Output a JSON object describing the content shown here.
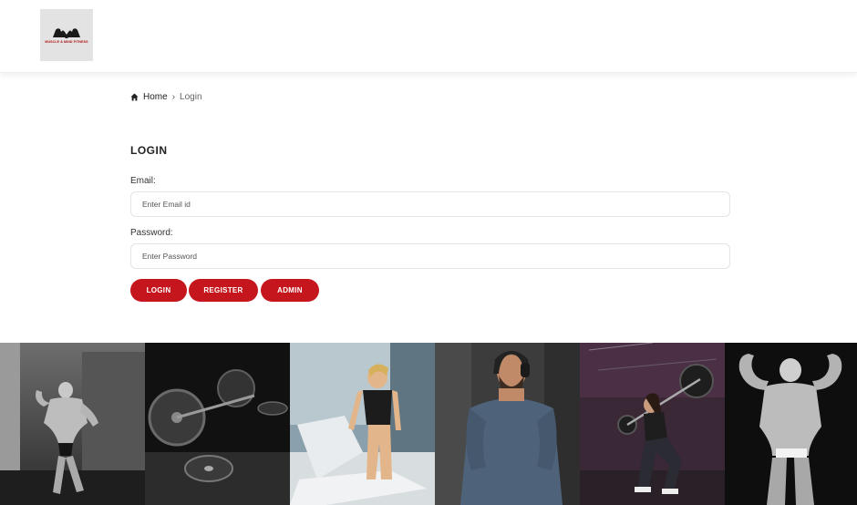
{
  "header": {
    "logo": {
      "brand_text": "MUSCLE & MIND FITNESS",
      "icon": "flexing-arms-logo"
    }
  },
  "breadcrumb": {
    "home_icon": "home-icon",
    "home_label": "Home",
    "separator": "›",
    "current_label": "Login"
  },
  "login_form": {
    "title": "LOGIN",
    "email_label": "Email:",
    "email_placeholder": "Enter Email id",
    "email_value": "",
    "password_label": "Password:",
    "password_placeholder": "Enter Password",
    "password_value": "",
    "login_button": "LOGIN",
    "register_button": "REGISTER",
    "admin_button": "ADMIN"
  },
  "gallery": {
    "images": [
      "bodybuilder-gym-photo",
      "barbell-weights-photo",
      "treadmill-runner-photo",
      "headphones-athlete-photo",
      "barbell-squat-photo",
      "bodybuilder-pose-photo"
    ]
  },
  "colors": {
    "accent": "#c4161c",
    "header_bg": "#ffffff",
    "logo_bg": "#e3e3e3"
  }
}
